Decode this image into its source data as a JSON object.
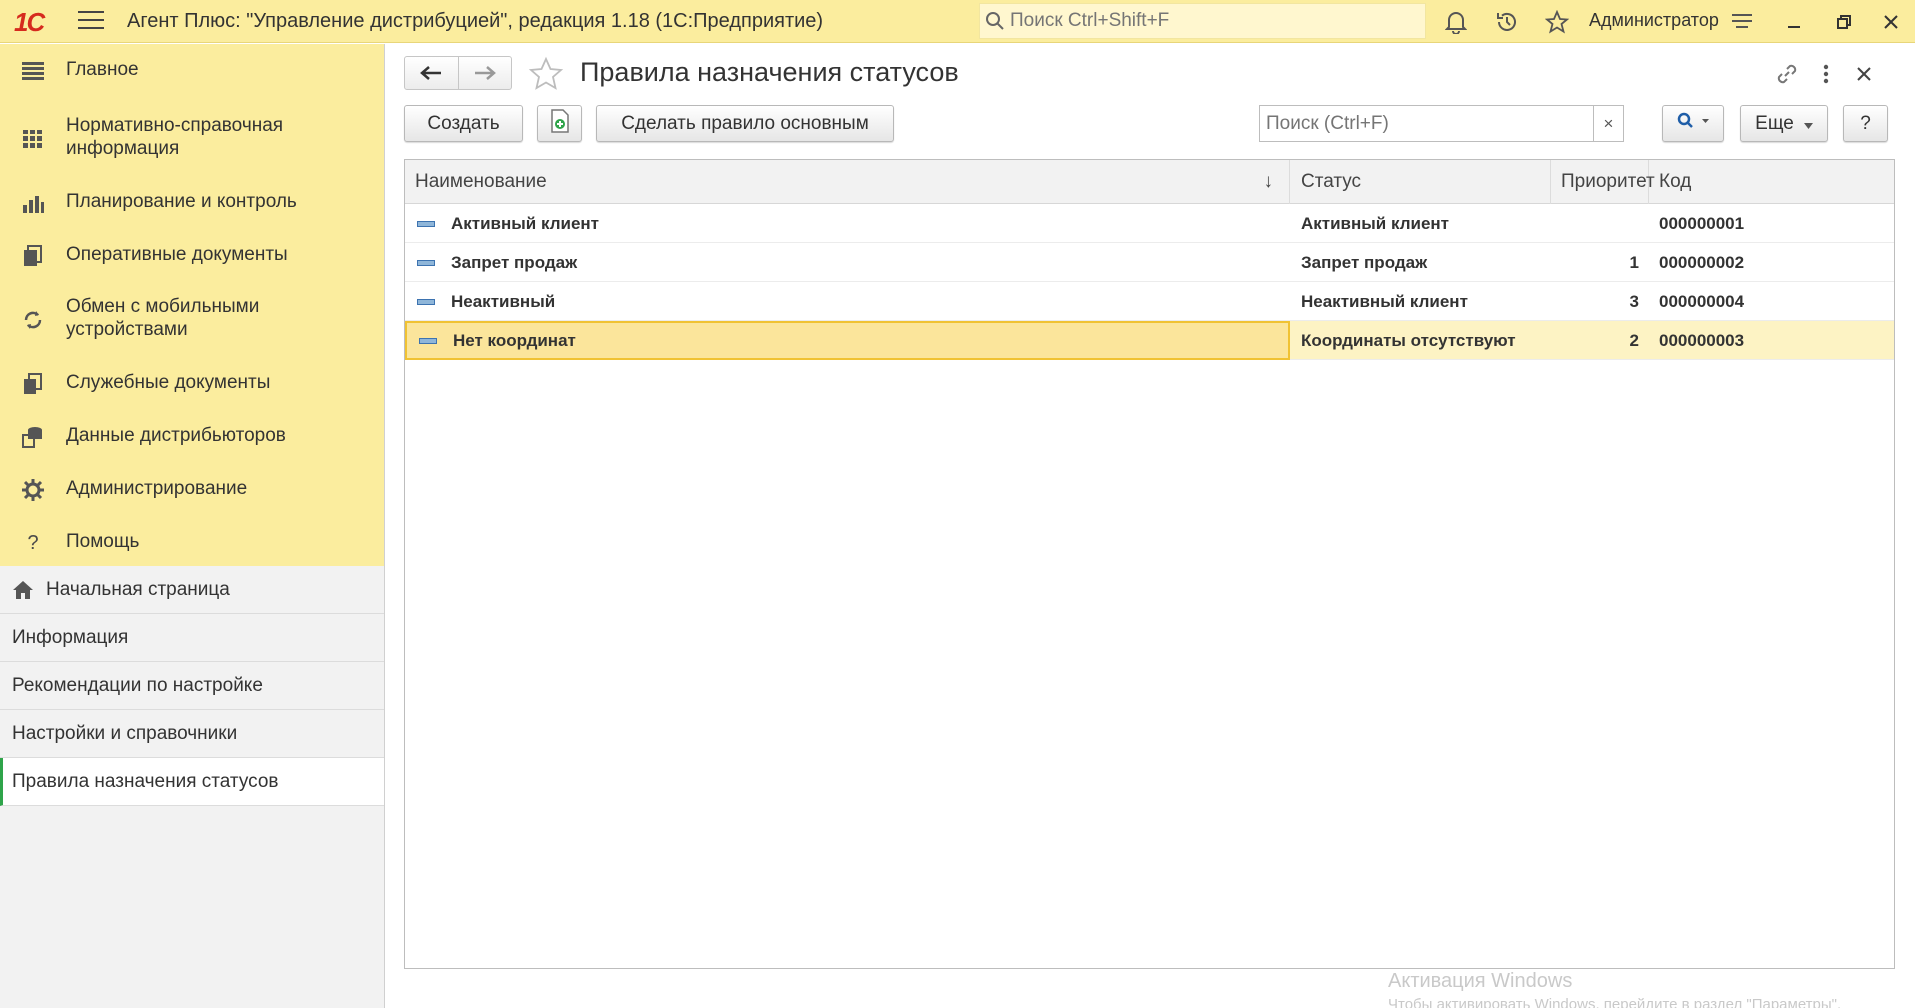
{
  "titlebar": {
    "logo": "1С",
    "app_title": "Агент Плюс: \"Управление дистрибуцией\", редакция 1.18  (1С:Предприятие)",
    "search_placeholder": "Поиск Ctrl+Shift+F",
    "user": "Администратор"
  },
  "sidebar": {
    "sections": [
      {
        "label": "Главное",
        "icon": "menu-lines-icon"
      },
      {
        "label": "Нормативно-справочная информация",
        "icon": "directory-icon"
      },
      {
        "label": "Планирование и контроль",
        "icon": "bar-chart-icon"
      },
      {
        "label": "Оперативные документы",
        "icon": "documents-icon"
      },
      {
        "label": "Обмен с мобильными устройствами",
        "icon": "sync-icon"
      },
      {
        "label": "Служебные документы",
        "icon": "service-docs-icon"
      },
      {
        "label": "Данные дистрибьюторов",
        "icon": "distributor-data-icon"
      },
      {
        "label": "Администрирование",
        "icon": "gear-icon"
      },
      {
        "label": "Помощь",
        "icon": "question-icon"
      }
    ],
    "open_windows": [
      {
        "label": "Начальная страница"
      },
      {
        "label": "Информация"
      },
      {
        "label": "Рекомендации по настройке"
      },
      {
        "label": "Настройки и справочники"
      },
      {
        "label": "Правила назначения статусов"
      }
    ]
  },
  "main": {
    "title": "Правила назначения статусов",
    "toolbar": {
      "create": "Создать",
      "make_main": "Сделать правило основным",
      "search_placeholder": "Поиск (Ctrl+F)",
      "clear": "×",
      "more": "Еще",
      "help": "?"
    },
    "table": {
      "columns": [
        "Наименование",
        "Статус",
        "Приоритет",
        "Код"
      ],
      "sort_indicator": "↓",
      "rows": [
        {
          "name": "Активный клиент",
          "status": "Активный клиент",
          "priority": "",
          "code": "000000001"
        },
        {
          "name": "Запрет продаж",
          "status": "Запрет продаж",
          "priority": "1",
          "code": "000000002"
        },
        {
          "name": "Неактивный",
          "status": "Неактивный клиент",
          "priority": "3",
          "code": "000000004"
        },
        {
          "name": "Нет координат",
          "status": "Координаты отсутствуют",
          "priority": "2",
          "code": "000000003"
        }
      ],
      "selected_row": 3
    }
  },
  "watermark": {
    "line1": "Активация Windows",
    "line2": "Чтобы активировать Windows, перейдите в раздел \"Параметры\"."
  },
  "colors": {
    "header_yellow": "#fbed9e",
    "selection": "#fbe59b",
    "active_marker": "#2fa44a",
    "logo_red": "#d62b1e"
  }
}
